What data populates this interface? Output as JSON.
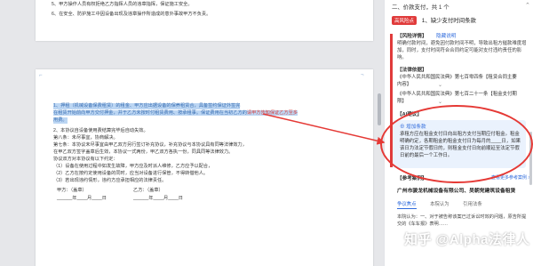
{
  "doc": {
    "page1_lines": [
      "5、甲方操作人员有权拒绝乙方指挥人员的违章指挥，保证施工安全。",
      "6、在安全、防护施工中因设备出现及违章操作所造成的意外事故甲方不负责。"
    ],
    "highlight_lines": [
      "1、押租（机械设备保费租赁）的租金、甲方应出据设备的保养租赁合，具备签约保证外签完",
      "在租赁开始前向甲方交付押金，并于乙方未按时付租赁费用、按承租事。",
      "保证费用在当初乙方的"
    ],
    "highlight_tail": "请甲方告知保证乙方至多",
    "highlight_end": "用费。",
    "body_lines": [
      "2、本协议自设备使用费结算完毕后自动失效。",
      "第八条：未尽事宜，协商解决。",
      "第七条：本协议未尽事宜由甲乙双方另行签订补充协议，补充协议与本协议具有同等法律效力，",
      "在甲乙双方签字盖章后生效，本协议一式两份，甲乙双方各执一份，同具同等法律效力。",
      "协议双方对本协议有以下约定：",
      "（1）设备在使用过程中如发生故障，甲方应及时派人维修，乙方应予以配合，",
      "（2）乙方在按约定使用设备的同时，应当对设备进行保管，不得转借他人。",
      "（3）若出现违约情形，违约方应承担相应的法律责任。"
    ],
    "sign_a": "甲方：（盖章）",
    "sign_b": "乙方：（盖章）",
    "date_a": "______年____月____日",
    "date_b": "______年____月____日"
  },
  "panel": {
    "header": "二、价款支付，共 1 个",
    "badge": "高风险点",
    "risk_title": "1、缺少支付时间条款",
    "risk_explain_label": "【风险详情】",
    "risk_explain_link": "隐藏说明",
    "risk_explain_text": "明确付款时间，避免因付款时间不明，导致出租方催款难度增加，同时，支付时间符合合同约定可能对支付违约责任的影响。",
    "law_label": "【法律依据】",
    "law1": "《中华人民共和国民法典》第七百零四条【租赁合同主要内容】",
    "law2": "《中华人民共和国民法典》第七百二十一条【租金支付期限】",
    "ai_label": "【AI建议】",
    "suggest_title": "增加条款",
    "suggest_text": "承租方应在租金支付日向出租方支付当期应付租金。租金明确约定，各期租金的租金支付日为每月的____日，如果该日为法定节假日的，则租金支付日向前顺延至法定节假日前的最后一个工作日。",
    "cases_label": "【参考案例】",
    "cases_more": "查看更多参考案例 >",
    "case_name": "广州市骏龙机械设备有限公司、吴朝党建筑设备租赁",
    "tabs": [
      "争议焦点",
      "本院认为",
      "引用法条"
    ],
    "case_text": "本院认为：一、对于被告称该案已过诉讼时效的问题，原告所提交的《车车报》表明……"
  },
  "watermark": "知乎 @Alpha法律人"
}
